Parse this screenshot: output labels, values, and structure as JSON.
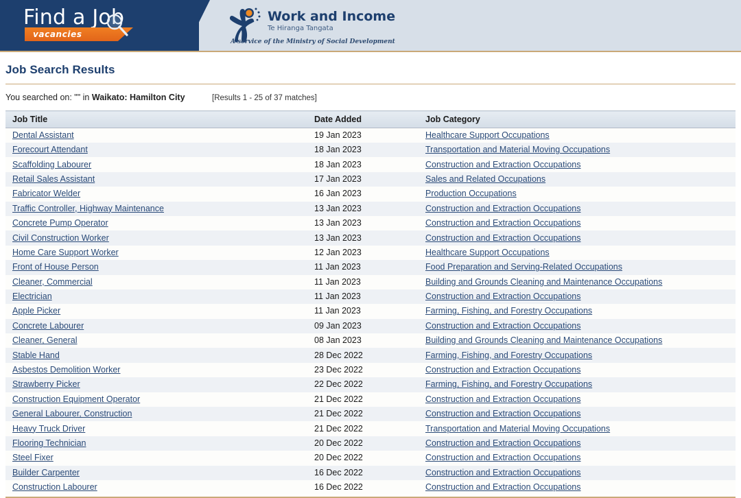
{
  "banner": {
    "find_a_job": {
      "title": "Find a Job",
      "badge": "vacancies"
    },
    "work_and_income": {
      "name": "Work and Income",
      "maori_name": "Te Hiranga Tangata",
      "tagline": "A service of the Ministry of Social Development"
    },
    "colors": {
      "navy": "#1d3f6e",
      "orange": "#e2651a",
      "band": "#d7dfe8",
      "rule": "#c9a978"
    }
  },
  "page": {
    "title": "Job Search Results",
    "searched_prefix": "You searched on: \"\" in",
    "searched_criteria": "Waikato: Hamilton City",
    "matches": "[Results 1 - 25 of 37 matches]"
  },
  "table": {
    "columns": [
      "Job Title",
      "Date Added",
      "Job Category"
    ],
    "rows": [
      {
        "title": "Dental Assistant",
        "date": "19 Jan 2023",
        "category": "Healthcare Support Occupations"
      },
      {
        "title": "Forecourt Attendant",
        "date": "18 Jan 2023",
        "category": "Transportation and Material Moving Occupations"
      },
      {
        "title": "Scaffolding Labourer",
        "date": "18 Jan 2023",
        "category": "Construction and Extraction Occupations"
      },
      {
        "title": "Retail Sales Assistant",
        "date": "17 Jan 2023",
        "category": "Sales and Related Occupations"
      },
      {
        "title": "Fabricator Welder",
        "date": "16 Jan 2023",
        "category": "Production Occupations"
      },
      {
        "title": "Traffic Controller, Highway Maintenance",
        "date": "13 Jan 2023",
        "category": "Construction and Extraction Occupations"
      },
      {
        "title": "Concrete Pump Operator",
        "date": "13 Jan 2023",
        "category": "Construction and Extraction Occupations"
      },
      {
        "title": "Civil Construction Worker",
        "date": "13 Jan 2023",
        "category": "Construction and Extraction Occupations"
      },
      {
        "title": "Home Care Support Worker",
        "date": "12 Jan 2023",
        "category": "Healthcare Support Occupations"
      },
      {
        "title": "Front of House Person",
        "date": "11 Jan 2023",
        "category": "Food Preparation and Serving-Related Occupations"
      },
      {
        "title": "Cleaner, Commercial",
        "date": "11 Jan 2023",
        "category": "Building and Grounds Cleaning and Maintenance Occupations"
      },
      {
        "title": "Electrician",
        "date": "11 Jan 2023",
        "category": "Construction and Extraction Occupations"
      },
      {
        "title": "Apple Picker",
        "date": "11 Jan 2023",
        "category": "Farming, Fishing, and Forestry Occupations"
      },
      {
        "title": "Concrete Labourer",
        "date": "09 Jan 2023",
        "category": "Construction and Extraction Occupations"
      },
      {
        "title": "Cleaner, General",
        "date": "08 Jan 2023",
        "category": "Building and Grounds Cleaning and Maintenance Occupations"
      },
      {
        "title": "Stable Hand",
        "date": "28 Dec 2022",
        "category": "Farming, Fishing, and Forestry Occupations"
      },
      {
        "title": "Asbestos Demolition Worker",
        "date": "23 Dec 2022",
        "category": "Construction and Extraction Occupations"
      },
      {
        "title": "Strawberry Picker",
        "date": "22 Dec 2022",
        "category": "Farming, Fishing, and Forestry Occupations"
      },
      {
        "title": "Construction Equipment Operator",
        "date": "21 Dec 2022",
        "category": "Construction and Extraction Occupations"
      },
      {
        "title": "General Labourer, Construction",
        "date": "21 Dec 2022",
        "category": "Construction and Extraction Occupations"
      },
      {
        "title": "Heavy Truck Driver",
        "date": "21 Dec 2022",
        "category": "Transportation and Material Moving Occupations"
      },
      {
        "title": "Flooring Technician",
        "date": "20 Dec 2022",
        "category": "Construction and Extraction Occupations"
      },
      {
        "title": "Steel Fixer",
        "date": "20 Dec 2022",
        "category": "Construction and Extraction Occupations"
      },
      {
        "title": "Builder Carpenter",
        "date": "16 Dec 2022",
        "category": "Construction and Extraction Occupations"
      },
      {
        "title": "Construction Labourer",
        "date": "16 Dec 2022",
        "category": "Construction and Extraction Occupations"
      }
    ]
  }
}
